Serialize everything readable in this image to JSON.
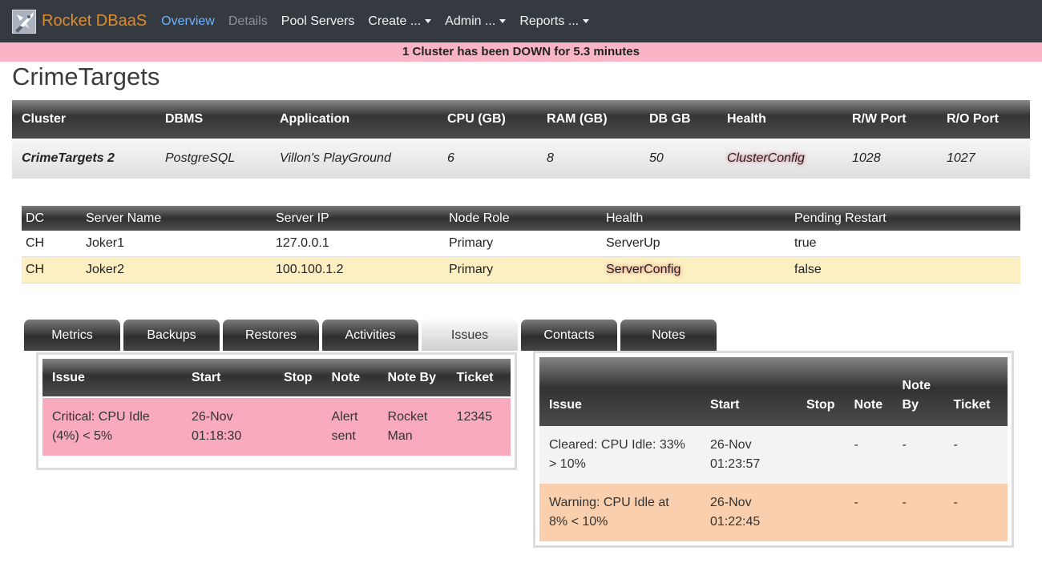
{
  "app": {
    "brand": "Rocket DBaaS"
  },
  "nav": {
    "overview": "Overview",
    "details": "Details",
    "pool_servers": "Pool Servers",
    "create": "Create ...",
    "admin": "Admin ...",
    "reports": "Reports ..."
  },
  "alert": {
    "text": "1 Cluster has been DOWN for 5.3 minutes"
  },
  "page": {
    "title": "CrimeTargets"
  },
  "cluster": {
    "headers": [
      "Cluster",
      "DBMS",
      "Application",
      "CPU (GB)",
      "RAM (GB)",
      "DB GB",
      "Health",
      "R/W Port",
      "R/O Port"
    ],
    "row": [
      "CrimeTargets 2",
      "PostgreSQL",
      "Villon's PlayGround",
      "6",
      "8",
      "50",
      "ClusterConfig",
      "1028",
      "1027"
    ]
  },
  "servers": {
    "headers": [
      "DC",
      "Server Name",
      "Server IP",
      "Node Role",
      "Health",
      "Pending Restart"
    ],
    "rows": [
      [
        "CH",
        "Joker1",
        "127.0.0.1",
        "Primary",
        "ServerUp",
        "true"
      ],
      [
        "CH",
        "Joker2",
        "100.100.1.2",
        "Primary",
        "ServerConfig",
        "false"
      ]
    ]
  },
  "tabs": [
    "Metrics",
    "Backups",
    "Restores",
    "Activities",
    "Issues",
    "Contacts",
    "Notes"
  ],
  "tabs_active": "Issues",
  "issues_open": {
    "headers": [
      "Issue",
      "Start",
      "Stop",
      "Note",
      "Note By",
      "Ticket"
    ],
    "rows": [
      [
        "Critical: CPU Idle (4%) < 5%",
        "26-Nov 01:18:30",
        "",
        "Alert sent",
        "Rocket Man",
        "12345"
      ]
    ]
  },
  "issues_closed": {
    "headers": [
      "Issue",
      "Start",
      "Stop",
      "Note",
      "Note By",
      "Ticket"
    ],
    "rows": [
      [
        "Cleared: CPU Idle: 33% > 10%",
        "26-Nov 01:23:57",
        "",
        "-",
        "-",
        "-"
      ],
      [
        "Warning: CPU Idle at 8% < 10%",
        "26-Nov 01:22:45",
        "",
        "-",
        "-",
        "-"
      ]
    ]
  },
  "colors": {
    "navbar": "#343a40",
    "brand": "#e08a2e",
    "active_link": "#6fb2ff",
    "alert_bg": "#f9b5c5",
    "critical_row": "#f9aabd",
    "warning_row": "#f9cfad",
    "server_warn_row": "#fcf0c2"
  }
}
